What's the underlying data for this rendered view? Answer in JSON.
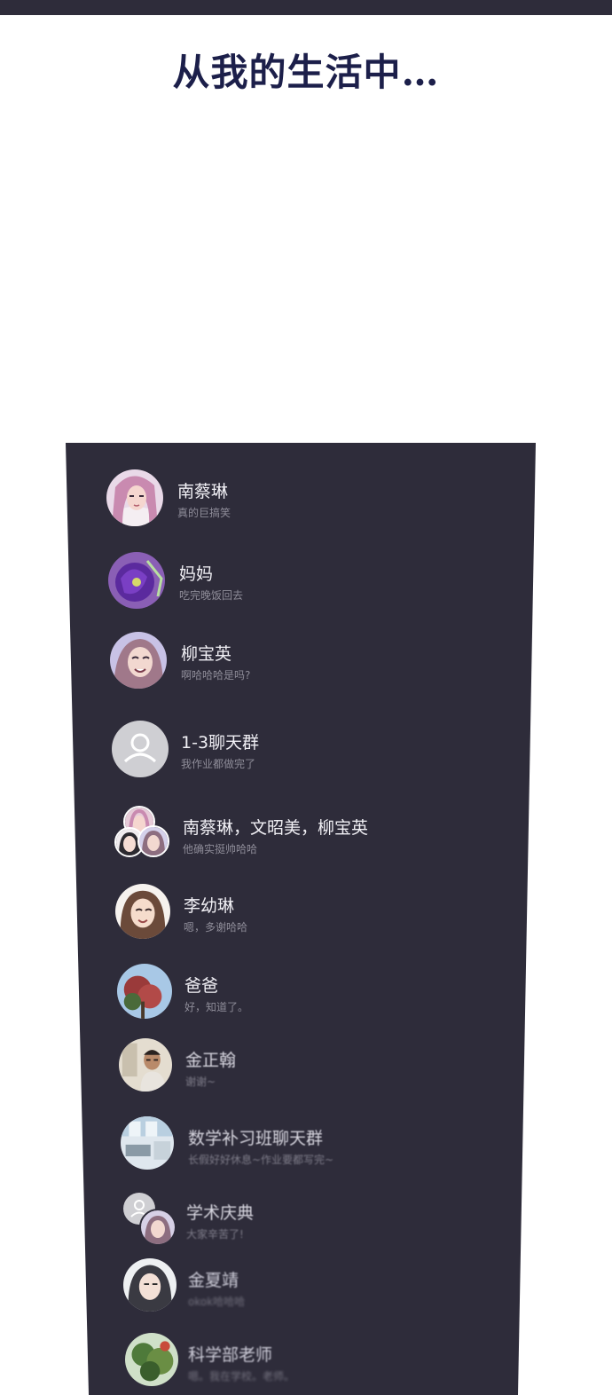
{
  "caption": "从我的生活中…",
  "chats": [
    {
      "name": "南蔡琳",
      "preview": "真的巨搞笑",
      "avatar_icon": "girl-pink-hair-avatar"
    },
    {
      "name": "妈妈",
      "preview": "吃完晚饭回去",
      "avatar_icon": "purple-flower-avatar"
    },
    {
      "name": "柳宝英",
      "preview": "啊哈哈哈是吗?",
      "avatar_icon": "girl-smiling-avatar"
    },
    {
      "name": "1-3聊天群",
      "preview": "我作业都做完了",
      "avatar_icon": "default-person-avatar"
    },
    {
      "name": "南蔡琳，文昭美，柳宝英",
      "preview": "他确实挺帅哈哈",
      "avatar_icon": "group-avatar"
    },
    {
      "name": "李幼琳",
      "preview": "嗯，多谢哈哈",
      "avatar_icon": "girl-brown-hair-avatar"
    },
    {
      "name": "爸爸",
      "preview": "好，知道了。",
      "avatar_icon": "red-tree-avatar"
    },
    {
      "name": "金正翰",
      "preview": "谢谢~",
      "avatar_icon": "man-glasses-avatar"
    },
    {
      "name": "数学补习班聊天群",
      "preview": "长假好好休息~作业要都写完~",
      "avatar_icon": "classroom-avatar"
    },
    {
      "name": "学术庆典",
      "preview": "大家辛苦了!",
      "avatar_icon": "group-avatar"
    },
    {
      "name": "金夏靖",
      "preview": "okok哈哈哈",
      "avatar_icon": "girl-dark-hair-avatar"
    },
    {
      "name": "科学部老师",
      "preview": "嗯。我在学校。老师。",
      "avatar_icon": "green-plant-avatar"
    }
  ],
  "colors": {
    "panel": "#2e2c3a",
    "name_text": "#f1f0f5",
    "preview_text": "#8e8c98",
    "caption": "#1c1f4a"
  }
}
